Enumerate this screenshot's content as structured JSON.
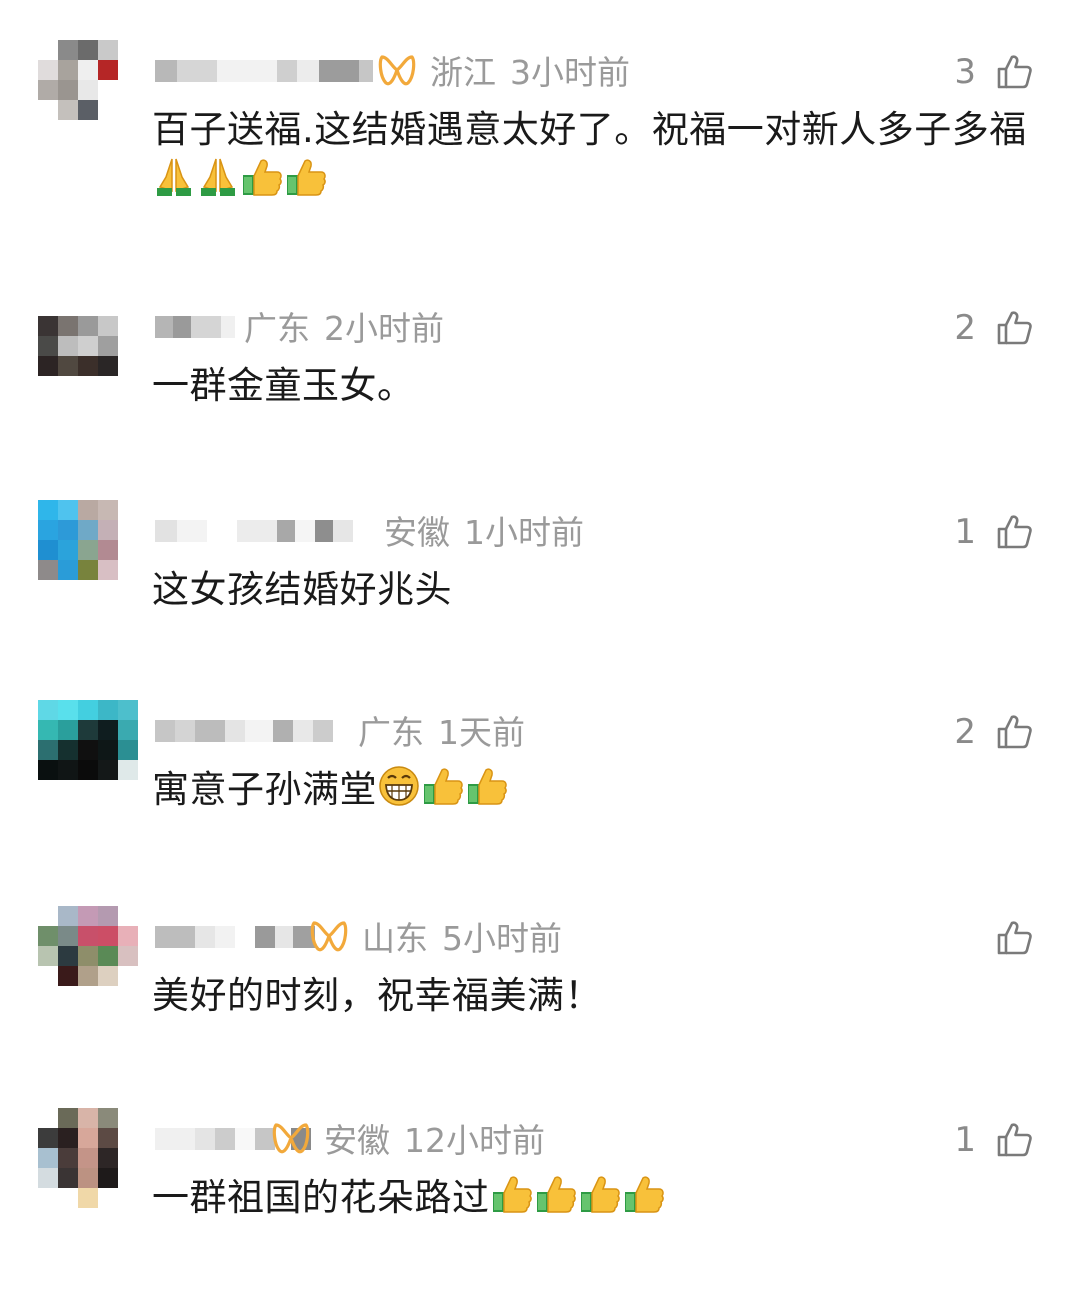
{
  "comments": [
    {
      "location": "浙江",
      "time": "3小时前",
      "likes": "3",
      "vip": true,
      "text": "百子送福.这结婚遇意太好了。祝福一对新人多子多福",
      "emojis": [
        "pray",
        "pray",
        "thumbs-up",
        "thumbs-up"
      ]
    },
    {
      "location": "广东",
      "time": "2小时前",
      "likes": "2",
      "vip": false,
      "text": "一群金童玉女。",
      "emojis": []
    },
    {
      "location": "安徽",
      "time": "1小时前",
      "likes": "1",
      "vip": false,
      "text": "这女孩结婚好兆头",
      "emojis": []
    },
    {
      "location": "广东",
      "time": "1天前",
      "likes": "2",
      "vip": false,
      "text": "寓意子孙满堂",
      "emojis": [
        "grin",
        "thumbs-up",
        "thumbs-up"
      ]
    },
    {
      "location": "山东",
      "time": "5小时前",
      "likes": "",
      "vip": true,
      "text": "美好的时刻，祝幸福美满！",
      "emojis": []
    },
    {
      "location": "安徽",
      "time": "12小时前",
      "likes": "1",
      "vip": true,
      "text": "一群祖国的花朵路过",
      "emojis": [
        "thumbs-up",
        "thumbs-up",
        "thumbs-up",
        "thumbs-up"
      ]
    }
  ]
}
